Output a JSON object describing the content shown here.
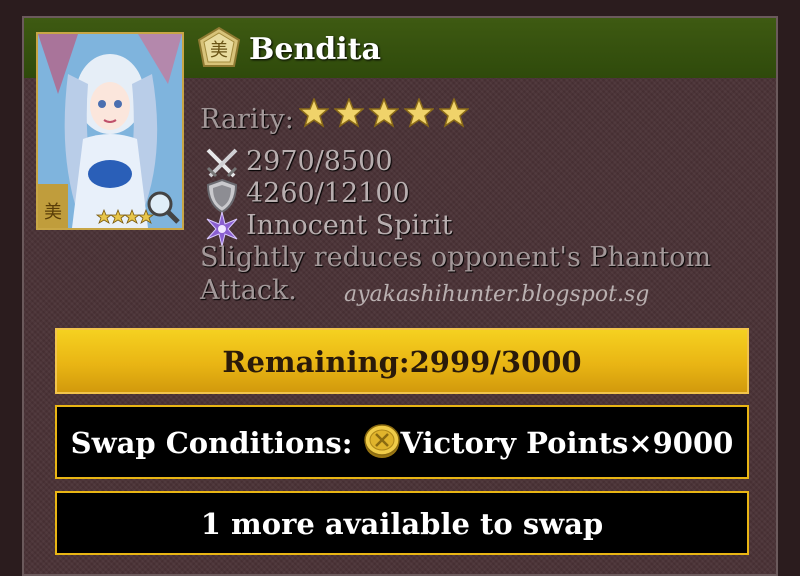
{
  "card": {
    "name": "Bendita",
    "attribute_icon": "attribute-emblem-icon",
    "rarity_label": "Rarity:",
    "rarity_stars": 5,
    "attack": "2970/8500",
    "defense": "4260/12100",
    "skill_name": "Innocent Spirit",
    "skill_desc_line1": "Slightly reduces opponent's Phantom",
    "skill_desc_line2": "Attack.",
    "watermark": "ayakashihunter.blogspot.sg"
  },
  "remaining": "Remaining:2999/3000",
  "swap": {
    "prefix": "Swap Conditions: ",
    "suffix": "Victory Points×9000",
    "coin_icon": "victory-coin-icon"
  },
  "availability": "1 more available to swap",
  "colors": {
    "header": "#3e5a12",
    "gold": "#e9b514",
    "panel": "#4a3236"
  }
}
